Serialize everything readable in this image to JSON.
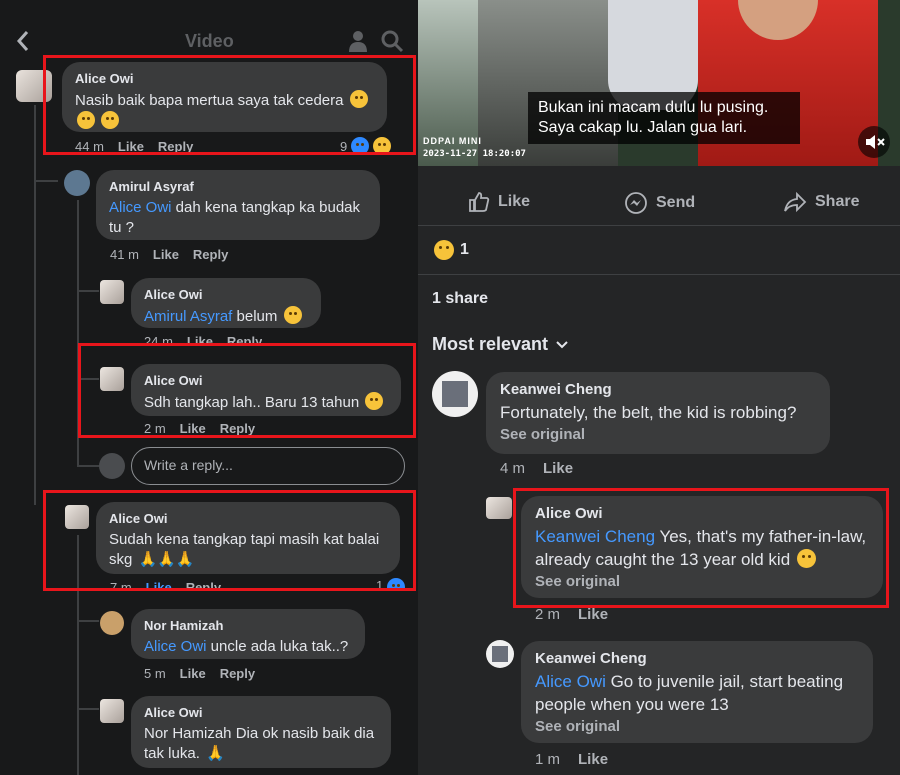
{
  "left": {
    "header_title": "Video",
    "comments": [
      {
        "name": "Alice Owi",
        "text": "Nasib baik bapa mertua saya tak cedera",
        "time": "44 m",
        "like": "Like",
        "reply": "Reply",
        "reactions": "9"
      },
      {
        "name": "Amirul Asyraf",
        "mention": "Alice Owi",
        "text": " dah kena tangkap ka budak tu ?",
        "time": "41 m",
        "like": "Like",
        "reply": "Reply"
      },
      {
        "name": "Alice Owi",
        "mention": "Amirul Asyraf",
        "text": " belum",
        "time": "24 m",
        "like": "Like",
        "reply": "Reply"
      },
      {
        "name": "Alice Owi",
        "text": "Sdh tangkap lah.. Baru 13 tahun",
        "time": "2 m",
        "like": "Like",
        "reply": "Reply"
      },
      {
        "name": "Alice Owi",
        "text": "Sudah kena tangkap tapi masih kat balai skg",
        "time": "7 m",
        "like": "Like",
        "reply": "Reply",
        "reactions": "1"
      },
      {
        "name": "Nor Hamizah",
        "mention": "Alice Owi",
        "text": " uncle ada luka tak..?",
        "time": "5 m",
        "like": "Like",
        "reply": "Reply"
      },
      {
        "name": "Alice Owi",
        "text": "Nor Hamizah Dia ok nasib baik dia tak luka."
      }
    ],
    "reply_placeholder": "Write a reply..."
  },
  "right": {
    "video": {
      "subtitle_line1": "Bukan ini macam dulu lu pusing.",
      "subtitle_line2": "Saya cakap lu. Jalan gua lari.",
      "timestamp": "2023-11-27 18:20:07",
      "brand": "DDPAI MINI"
    },
    "actions": {
      "like": "Like",
      "send": "Send",
      "share": "Share"
    },
    "reaction_count": "1",
    "shares": "1 share",
    "sort_label": "Most relevant",
    "comments": [
      {
        "name": "Keanwei Cheng",
        "text": "Fortunately, the belt, the kid is robbing?",
        "see": "See original",
        "time": "4 m",
        "like": "Like"
      },
      {
        "name": "Alice Owi",
        "mention": "Keanwei Cheng",
        "text": " Yes, that's my father-in-law, already caught the 13 year old kid",
        "see": "See original",
        "time": "2 m",
        "like": "Like"
      },
      {
        "name": "Keanwei Cheng",
        "mention": "Alice Owi",
        "text": " Go to juvenile jail, start beating people when you were 13",
        "see": "See original",
        "time": "1 m",
        "like": "Like"
      }
    ]
  },
  "colors": {
    "accent": "#4599ff",
    "highlight": "#e8151b",
    "bubble": "#3a3b3c"
  }
}
